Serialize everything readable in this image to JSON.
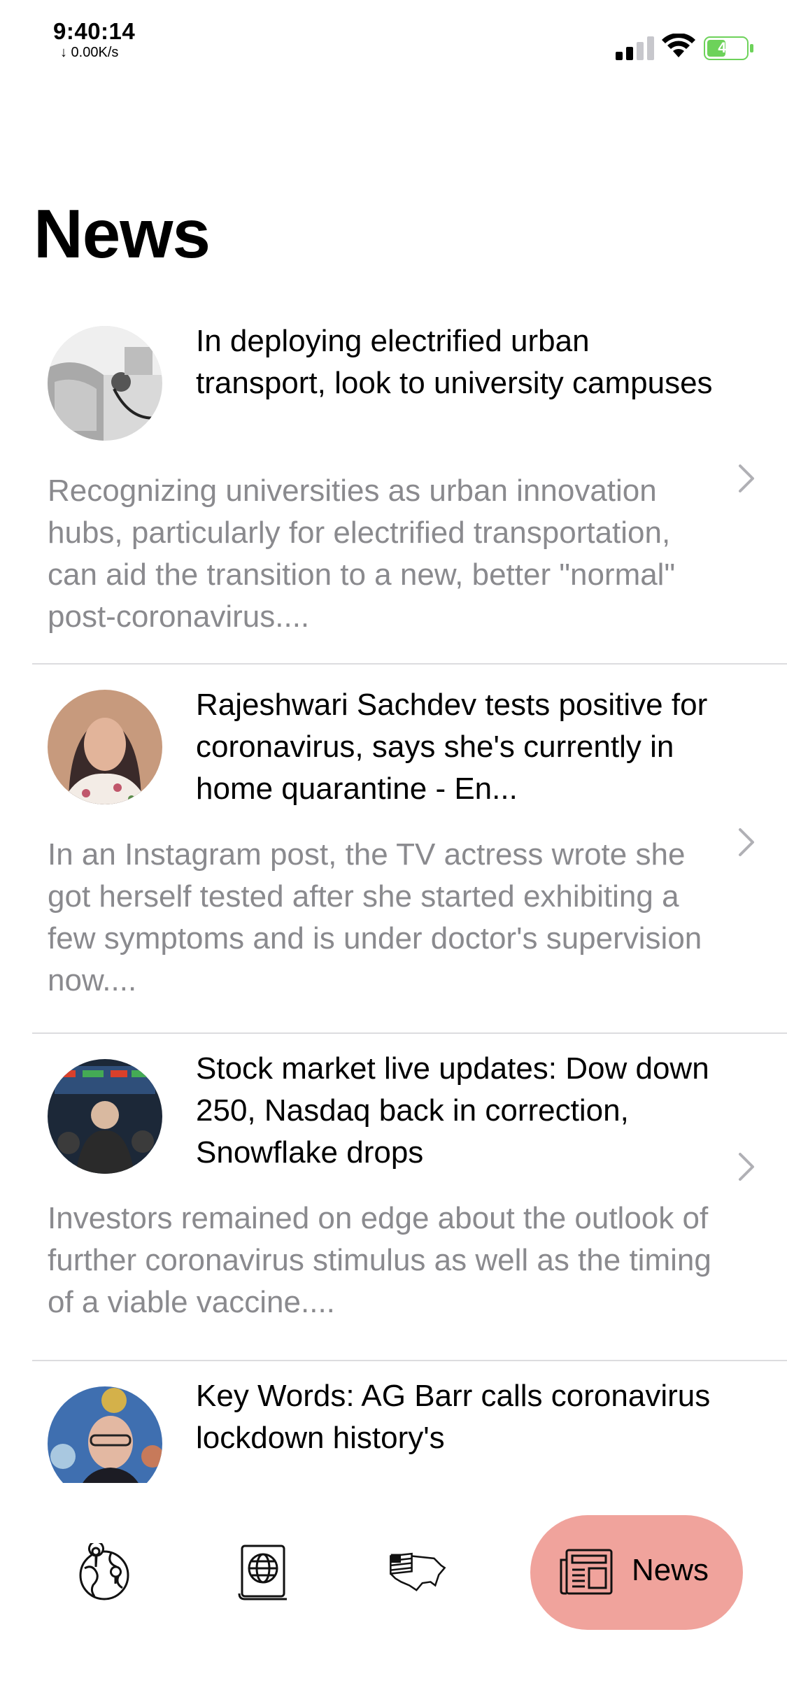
{
  "status_bar": {
    "time": "9:40:14",
    "net_speed": "↓ 0.00K/s",
    "battery_level": "41",
    "battery_color": "#6dd25a"
  },
  "page": {
    "title": "News"
  },
  "news": [
    {
      "headline": "In deploying electrified urban transport, look to university campuses",
      "summary": "Recognizing universities as urban innovation hubs, particularly for electrified transportation, can aid the transition to a new, better \"normal\" post-coronavirus....",
      "thumb": "electric-car-charging"
    },
    {
      "headline": "Rajeshwari Sachdev tests positive for coronavirus, says she's currently in home quarantine - En...",
      "summary": "In an Instagram post, the TV actress wrote she got herself tested after she started exhibiting a few symptoms and is under doctor's supervision now....",
      "thumb": "woman-portrait"
    },
    {
      "headline": "Stock market live updates: Dow down 250, Nasdaq back in correction, Snowflake drops",
      "summary": "Investors remained on edge about the outlook of further coronavirus stimulus as well as the timing of a viable vaccine....",
      "thumb": "stock-exchange-floor"
    },
    {
      "headline": "Key Words: AG Barr calls coronavirus lockdown history's",
      "summary": "",
      "thumb": "man-press-conference"
    }
  ],
  "tab_bar": {
    "tabs": [
      {
        "icon": "globe-location-icon"
      },
      {
        "icon": "passport-globe-icon"
      },
      {
        "icon": "usa-flag-map-icon"
      },
      {
        "icon": "newspaper-icon",
        "label": "News",
        "active": true
      }
    ],
    "active_color": "#f0a39c"
  }
}
